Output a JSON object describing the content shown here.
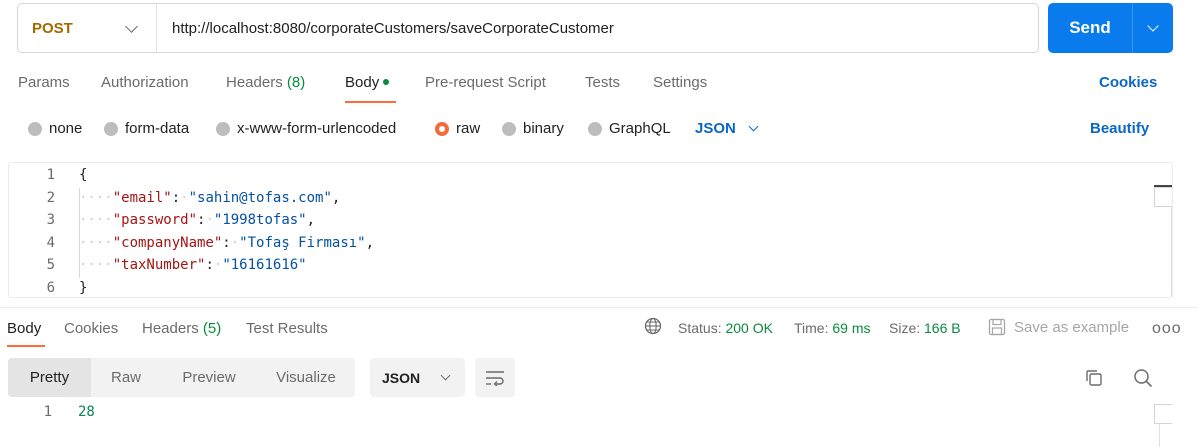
{
  "request": {
    "method": "POST",
    "url": "http://localhost:8080/corporateCustomers/saveCorporateCustomer",
    "send_label": "Send"
  },
  "request_tabs": {
    "params": "Params",
    "authorization": "Authorization",
    "headers_label": "Headers",
    "headers_count": "(8)",
    "body": "Body",
    "pre_request": "Pre-request Script",
    "tests": "Tests",
    "settings": "Settings",
    "cookies": "Cookies"
  },
  "body_types": {
    "none": "none",
    "form_data": "form-data",
    "urlencoded": "x-www-form-urlencoded",
    "raw": "raw",
    "binary": "binary",
    "graphql": "GraphQL",
    "selected": "raw",
    "language": "JSON",
    "beautify": "Beautify"
  },
  "editor": {
    "lines": [
      {
        "n": "1",
        "text": "{"
      },
      {
        "n": "2",
        "key": "\"email\"",
        "value": "\"sahin@tofas.com\"",
        "trail": ","
      },
      {
        "n": "3",
        "key": "\"password\"",
        "value": "\"1998tofas\"",
        "trail": ","
      },
      {
        "n": "4",
        "key": "\"companyName\"",
        "value": "\"Tofaş Firması\"",
        "trail": ","
      },
      {
        "n": "5",
        "key": "\"taxNumber\"",
        "value": "\"16161616\"",
        "trail": ""
      },
      {
        "n": "6",
        "text": "}"
      }
    ]
  },
  "response_tabs": {
    "body": "Body",
    "cookies": "Cookies",
    "headers_label": "Headers",
    "headers_count": "(5)",
    "test_results": "Test Results"
  },
  "response_meta": {
    "status_label": "Status:",
    "status_value": "200 OK",
    "time_label": "Time:",
    "time_value": "69 ms",
    "size_label": "Size:",
    "size_value": "166 B",
    "save_example": "Save as example",
    "more": "ooo"
  },
  "response_view": {
    "pretty": "Pretty",
    "raw": "Raw",
    "preview": "Preview",
    "visualize": "Visualize",
    "format": "JSON"
  },
  "response_body": {
    "line_number": "1",
    "value": "28"
  },
  "colors": {
    "accent": "#097bed",
    "tab_underline": "#ff6c37",
    "method": "#a36800",
    "link": "#0a67c5",
    "success": "#0a8a3c"
  }
}
